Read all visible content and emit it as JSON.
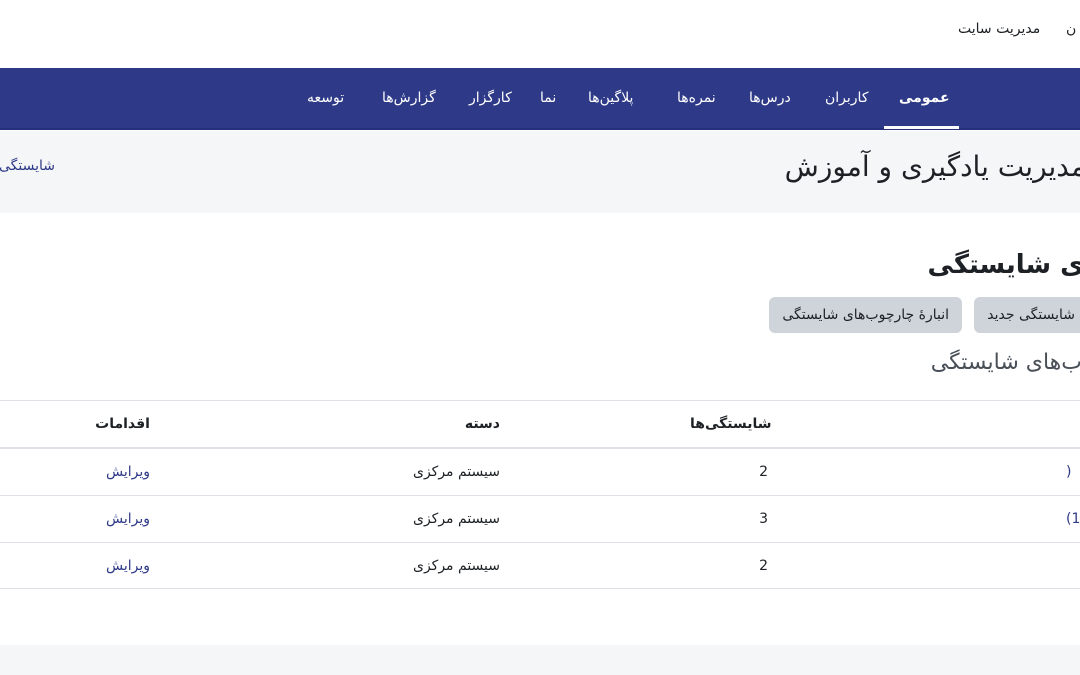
{
  "topbar": {
    "site_admin": "مدیریت سایت",
    "partial_item": "ن"
  },
  "nav": {
    "items": [
      {
        "label": "عمومی"
      },
      {
        "label": "کاربران"
      },
      {
        "label": "درس‌ها"
      },
      {
        "label": "نمره‌ها"
      },
      {
        "label": "پلاگین‌ها"
      },
      {
        "label": "نما"
      },
      {
        "label": "کارگزار"
      },
      {
        "label": "گزارش‌ها"
      },
      {
        "label": "توسعه"
      }
    ],
    "active_index": 0
  },
  "header": {
    "title": "مدیریت یادگیری و آموزش",
    "breadcrumb_partial": "شایستگی"
  },
  "main": {
    "section_title": "ی شایستگی",
    "buttons": {
      "browse": "انبارهٔ چارچوب‌های شایستگی",
      "add": "شایستگی جدید"
    },
    "subtitle": "ب‌های شایستگی"
  },
  "table": {
    "headers": {
      "count": "شایستگی‌ها",
      "category": "دسته",
      "actions": "اقدامات"
    },
    "rows": [
      {
        "name_partial": ")",
        "count": "2",
        "category": "سیستم مرکزی",
        "action": "ویرایش"
      },
      {
        "name_partial": "(1",
        "count": "3",
        "category": "سیستم مرکزی",
        "action": "ویرایش"
      },
      {
        "name_partial": "",
        "count": "2",
        "category": "سیستم مرکزی",
        "action": "ویرایش"
      }
    ]
  },
  "colors": {
    "navbar": "#2e3a87",
    "link": "#2e3a87",
    "band": "#f5f6f8",
    "button": "#ced4da"
  }
}
